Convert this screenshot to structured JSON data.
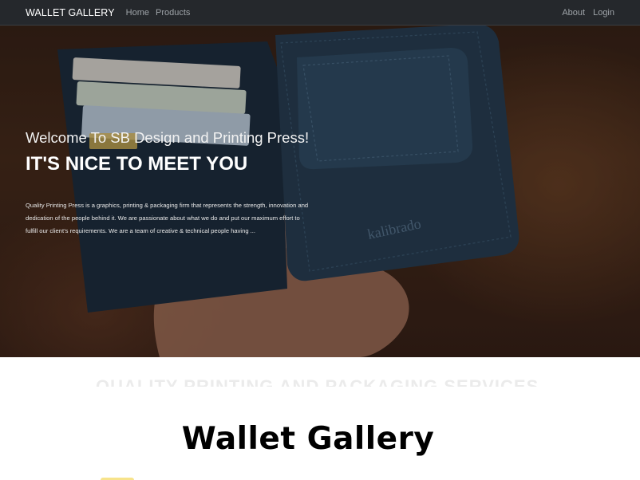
{
  "navbar": {
    "brand": "WALLET GALLERY",
    "links": [
      "Home",
      "Products"
    ],
    "right_links": [
      "About",
      "Login"
    ]
  },
  "hero": {
    "subtitle": "Welcome To SB Design and Printing Press!",
    "title": "IT'S NICE TO MEET YOU",
    "description": "Quality Printing Press is a graphics, printing & packaging firm that represents the strength, innovation and dedication of the people behind it. We are passionate about what we do and put our maximum effort to fulfill our client’s requirements. We are a team of creative & technical people having ...",
    "image_brand_text": "kalibrado"
  },
  "section": {
    "title": "Wallet Gallery"
  },
  "colors": {
    "navbar_bg": "#25282c",
    "brand_text": "#ffffff",
    "nav_link": "#9ea3a8",
    "wallet": "#26384a",
    "accent": "#f4d75a"
  },
  "icons": []
}
